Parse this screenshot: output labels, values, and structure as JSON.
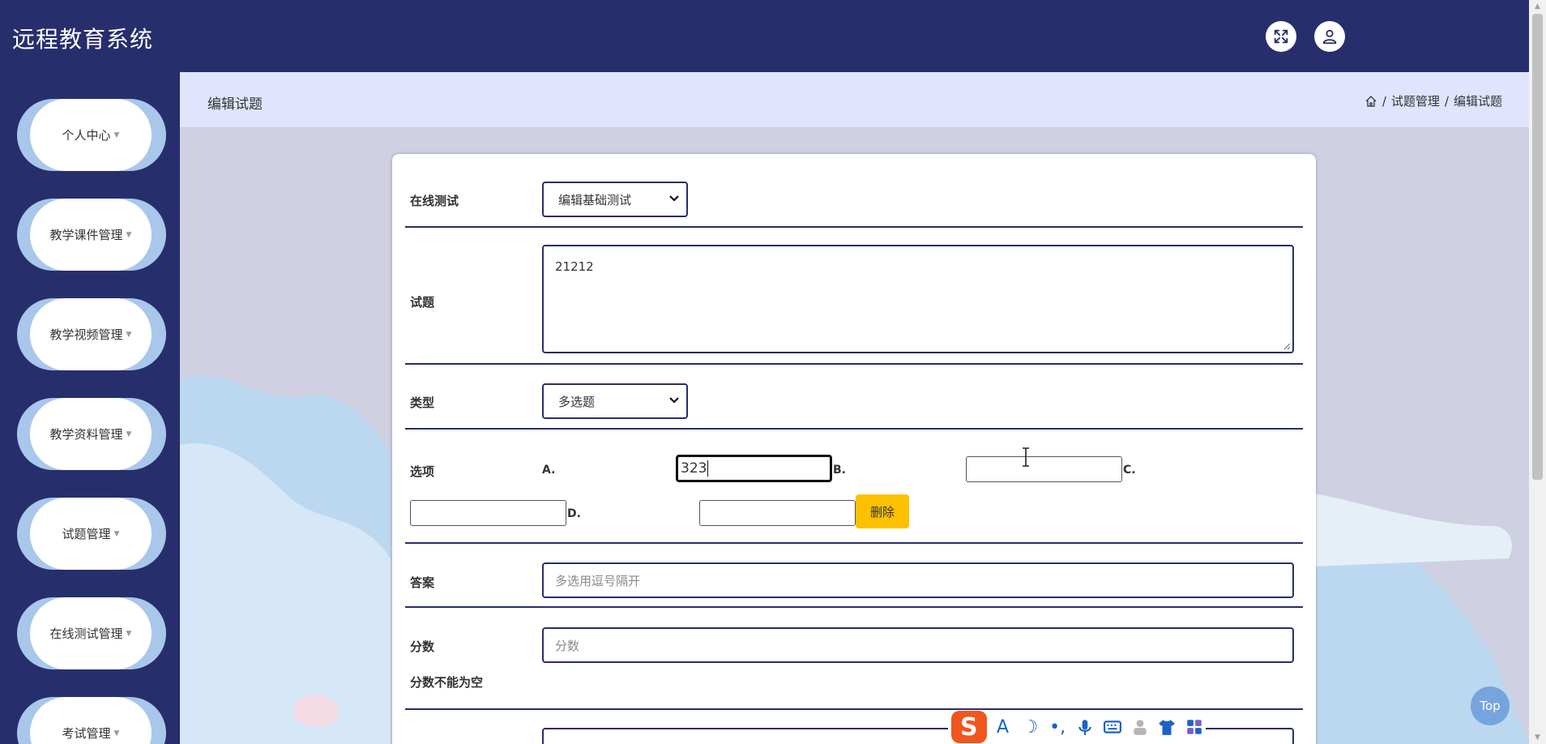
{
  "header": {
    "title": "远程教育系统"
  },
  "sidebar": {
    "items": [
      {
        "label": "个人中心"
      },
      {
        "label": "教学课件管理"
      },
      {
        "label": "教学视频管理"
      },
      {
        "label": "教学资料管理"
      },
      {
        "label": "试题管理"
      },
      {
        "label": "在线测试管理"
      },
      {
        "label": "考试管理"
      }
    ],
    "caret": "▼"
  },
  "page": {
    "title": "编辑试题",
    "breadcrumb": {
      "sep": "/",
      "level1": "试题管理",
      "level2": "编辑试题"
    }
  },
  "form": {
    "test": {
      "label": "在线测试",
      "value": "编辑基础测试"
    },
    "question": {
      "label": "试题",
      "value": "21212"
    },
    "type": {
      "label": "类型",
      "value": "多选题"
    },
    "options": {
      "label": "选项",
      "a_label": "A.",
      "a_value": "323",
      "b_label": "B.",
      "b_value": "",
      "c_label": "C.",
      "c_value": "",
      "d_label": "D.",
      "d_value": "",
      "delete_label": "删除"
    },
    "answer": {
      "label": "答案",
      "placeholder": "多选用逗号隔开"
    },
    "score": {
      "label": "分数",
      "placeholder": "分数",
      "error": "分数不能为空"
    }
  },
  "top_button": "Top",
  "ime": {
    "logo": "S",
    "font": "A",
    "moon": "☽",
    "punct": "•,"
  }
}
